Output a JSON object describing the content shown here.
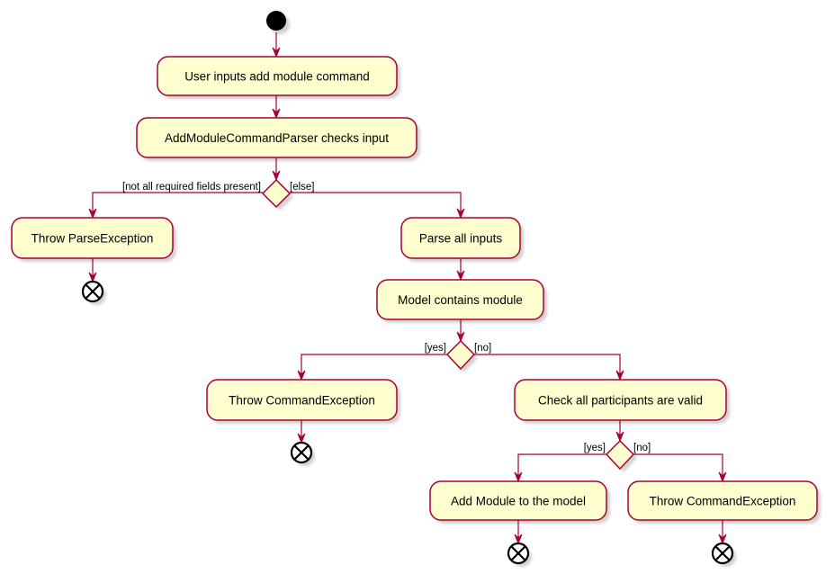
{
  "diagram": {
    "type": "activity",
    "colors": {
      "activity_fill": "#FEFECE",
      "border": "#A80036",
      "arrow": "#A80036",
      "start_node": "#000000"
    },
    "nodes": {
      "start": {
        "kind": "start"
      },
      "a1": {
        "kind": "activity",
        "label": "User inputs add module command"
      },
      "a2": {
        "kind": "activity",
        "label": "AddModuleCommandParser checks input"
      },
      "d1": {
        "kind": "decision"
      },
      "a3": {
        "kind": "activity",
        "label": "Throw ParseException"
      },
      "e1": {
        "kind": "end"
      },
      "a4": {
        "kind": "activity",
        "label": "Parse all inputs"
      },
      "a5": {
        "kind": "activity",
        "label": "Model contains module"
      },
      "d2": {
        "kind": "decision"
      },
      "a6": {
        "kind": "activity",
        "label": "Throw CommandException"
      },
      "e2": {
        "kind": "end"
      },
      "a7": {
        "kind": "activity",
        "label": "Check all participants are valid"
      },
      "d3": {
        "kind": "decision"
      },
      "a8": {
        "kind": "activity",
        "label": "Add Module to the model"
      },
      "e3": {
        "kind": "end"
      },
      "a9": {
        "kind": "activity",
        "label": "Throw CommandException"
      },
      "e4": {
        "kind": "end"
      }
    },
    "guards": {
      "d1_left": "[not all required fields present]",
      "d1_right": "[else]",
      "d2_left": "[yes]",
      "d2_right": "[no]",
      "d3_left": "[yes]",
      "d3_right": "[no]"
    },
    "edges": [
      {
        "from": "start",
        "to": "a1"
      },
      {
        "from": "a1",
        "to": "a2"
      },
      {
        "from": "a2",
        "to": "d1"
      },
      {
        "from": "d1",
        "to": "a3",
        "guard": "[not all required fields present]"
      },
      {
        "from": "d1",
        "to": "a4",
        "guard": "[else]"
      },
      {
        "from": "a3",
        "to": "e1"
      },
      {
        "from": "a4",
        "to": "a5"
      },
      {
        "from": "a5",
        "to": "d2"
      },
      {
        "from": "d2",
        "to": "a6",
        "guard": "[yes]"
      },
      {
        "from": "d2",
        "to": "a7",
        "guard": "[no]"
      },
      {
        "from": "a6",
        "to": "e2"
      },
      {
        "from": "a7",
        "to": "d3"
      },
      {
        "from": "d3",
        "to": "a8",
        "guard": "[yes]"
      },
      {
        "from": "d3",
        "to": "a9",
        "guard": "[no]"
      },
      {
        "from": "a8",
        "to": "e3"
      },
      {
        "from": "a9",
        "to": "e4"
      }
    ]
  }
}
